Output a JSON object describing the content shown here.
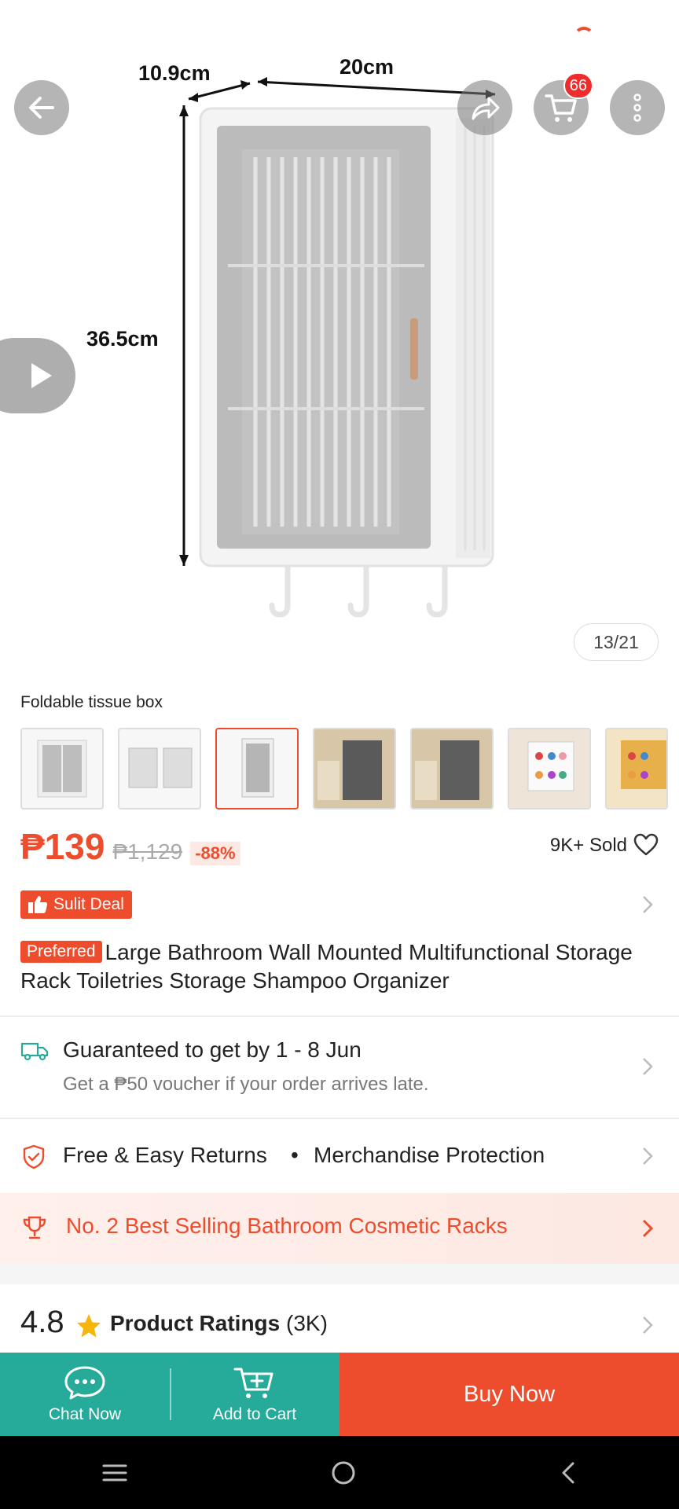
{
  "hero": {
    "dim_depth": "10.9cm",
    "dim_width": "20cm",
    "dim_height": "36.5cm",
    "cart_count": "66",
    "image_counter": "13/21",
    "icons": [
      "back-arrow-icon",
      "share-icon",
      "cart-icon",
      "more-vertical-icon",
      "play-icon"
    ]
  },
  "variation": {
    "selected_name": "Foldable tissue box",
    "selected_index": 2
  },
  "price": {
    "current": "₱139",
    "original": "₱1,129",
    "discount": "-88%",
    "sold": "9K+ Sold"
  },
  "deal": {
    "label": "Sulit Deal"
  },
  "product": {
    "badge": "Preferred",
    "title": "Large Bathroom Wall Mounted  Multifunctional Storage Rack Toiletries Storage Shampoo Organizer"
  },
  "shipping": {
    "title": "Guaranteed to get by 1 - 8 Jun",
    "subtitle": "Get a ₱50 voucher if your order arrives late."
  },
  "protection": {
    "returns": "Free & Easy Returns",
    "bullet": "•",
    "merch": "Merchandise Protection"
  },
  "bestseller": {
    "label": "No. 2 Best Selling Bathroom Cosmetic Racks"
  },
  "ratings": {
    "score": "4.8",
    "label": "Product Ratings",
    "count": "(3K)"
  },
  "bottom_bar": {
    "chat_label": "Chat Now",
    "cart_label": "Add to Cart",
    "buy_label": "Buy Now"
  },
  "colors": {
    "brand": "#ee4d2d",
    "teal": "#26aa99"
  }
}
